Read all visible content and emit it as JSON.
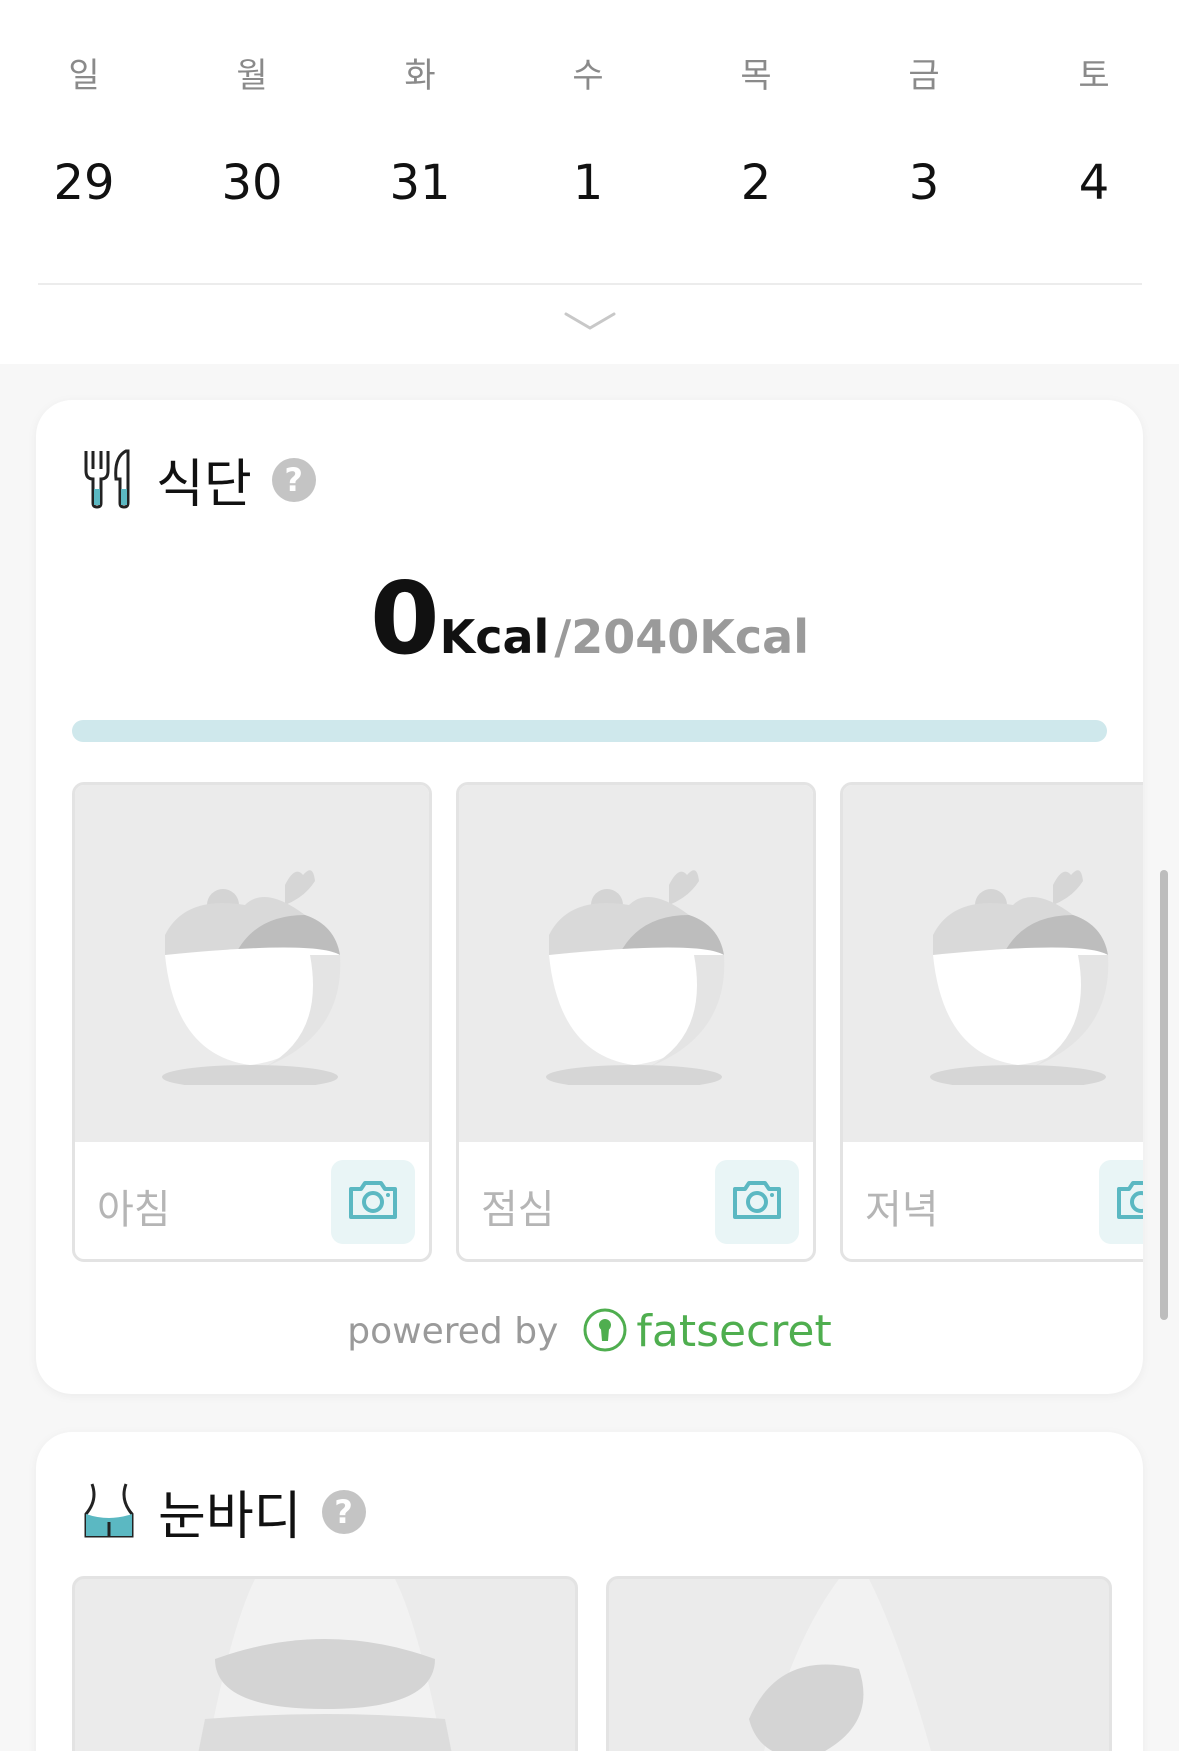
{
  "calendar": {
    "weekdays": [
      "일",
      "월",
      "화",
      "수",
      "목",
      "금",
      "토"
    ],
    "dates": [
      "29",
      "30",
      "31",
      "1",
      "2",
      "3",
      "4"
    ]
  },
  "diet": {
    "title": "식단",
    "kcal_current": "0",
    "kcal_unit": "Kcal",
    "kcal_goal": "/2040Kcal",
    "progress_fraction": 0,
    "meals": [
      {
        "label": "아침"
      },
      {
        "label": "점심"
      },
      {
        "label": "저녁"
      }
    ],
    "powered_by": "powered by",
    "provider": "fatsecret"
  },
  "body": {
    "title": "눈바디"
  },
  "colors": {
    "accent": "#5bb8c2",
    "progress_track": "#cfe8ec",
    "fatsecret_green": "#4fae4f"
  }
}
